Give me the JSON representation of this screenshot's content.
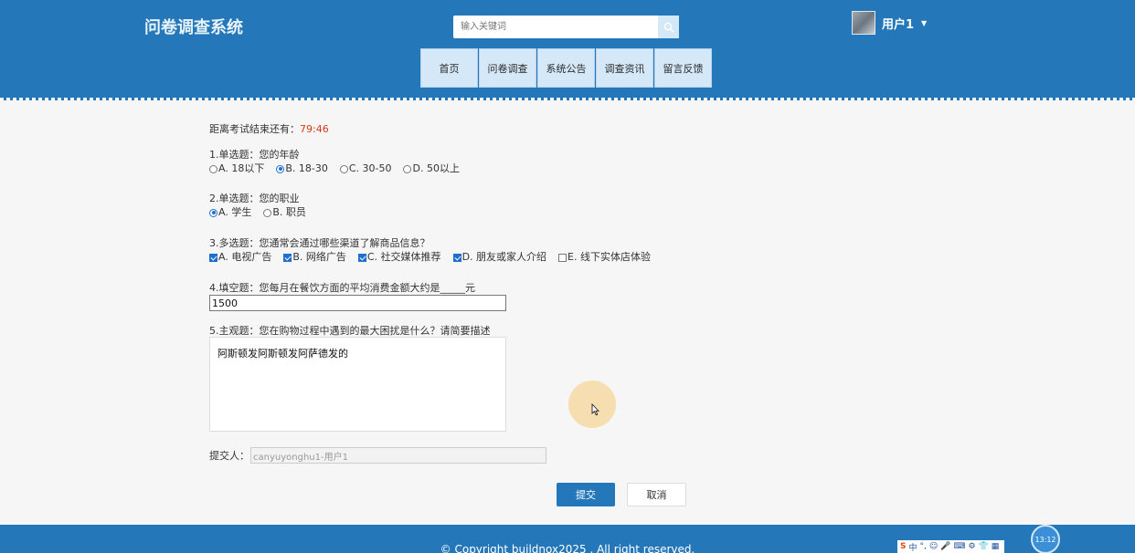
{
  "header": {
    "site_title": "问卷调查系统",
    "search_placeholder": "输入关键词",
    "user_name": "用户1"
  },
  "nav": [
    "首页",
    "问卷调查",
    "系统公告",
    "调查资讯",
    "留言反馈"
  ],
  "exam": {
    "timer_label": "距离考试结束还有：",
    "timer_value": "79:46"
  },
  "questions": [
    {
      "title": "1.单选题：您的年龄",
      "type": "radio",
      "options": [
        {
          "label": "A. 18以下",
          "checked": false
        },
        {
          "label": "B. 18-30",
          "checked": true
        },
        {
          "label": "C. 30-50",
          "checked": false
        },
        {
          "label": "D. 50以上",
          "checked": false
        }
      ]
    },
    {
      "title": "2.单选题：您的职业",
      "type": "radio",
      "options": [
        {
          "label": "A. 学生",
          "checked": true
        },
        {
          "label": "B. 职员",
          "checked": false
        }
      ]
    },
    {
      "title": "3.多选题：您通常会通过哪些渠道了解商品信息？",
      "type": "checkbox",
      "options": [
        {
          "label": "A. 电视广告",
          "checked": true
        },
        {
          "label": "B. 网络广告",
          "checked": true
        },
        {
          "label": "C. 社交媒体推荐",
          "checked": true
        },
        {
          "label": "D. 朋友或家人介绍",
          "checked": true
        },
        {
          "label": "E. 线下实体店体验",
          "checked": false
        }
      ]
    },
    {
      "title": "4.填空题：您每月在餐饮方面的平均消费金额大约是_____元",
      "type": "fill",
      "value": "1500"
    },
    {
      "title": "5.主观题：您在购物过程中遇到的最大困扰是什么？请简要描述",
      "type": "text",
      "value": "阿斯顿发阿斯顿发阿萨德发的"
    }
  ],
  "submitter": {
    "label": "提交人：",
    "value": "canyuyonghu1-用户1"
  },
  "buttons": {
    "submit": "提交",
    "cancel": "取消"
  },
  "footer": {
    "copyright": "© Copyright buildnox2025 . All right reserved.",
    "ime_chars": [
      "中",
      "°,",
      "☺",
      "🎤",
      "⌨",
      "⚙",
      "👕",
      "▦"
    ],
    "clock": "13:12"
  }
}
